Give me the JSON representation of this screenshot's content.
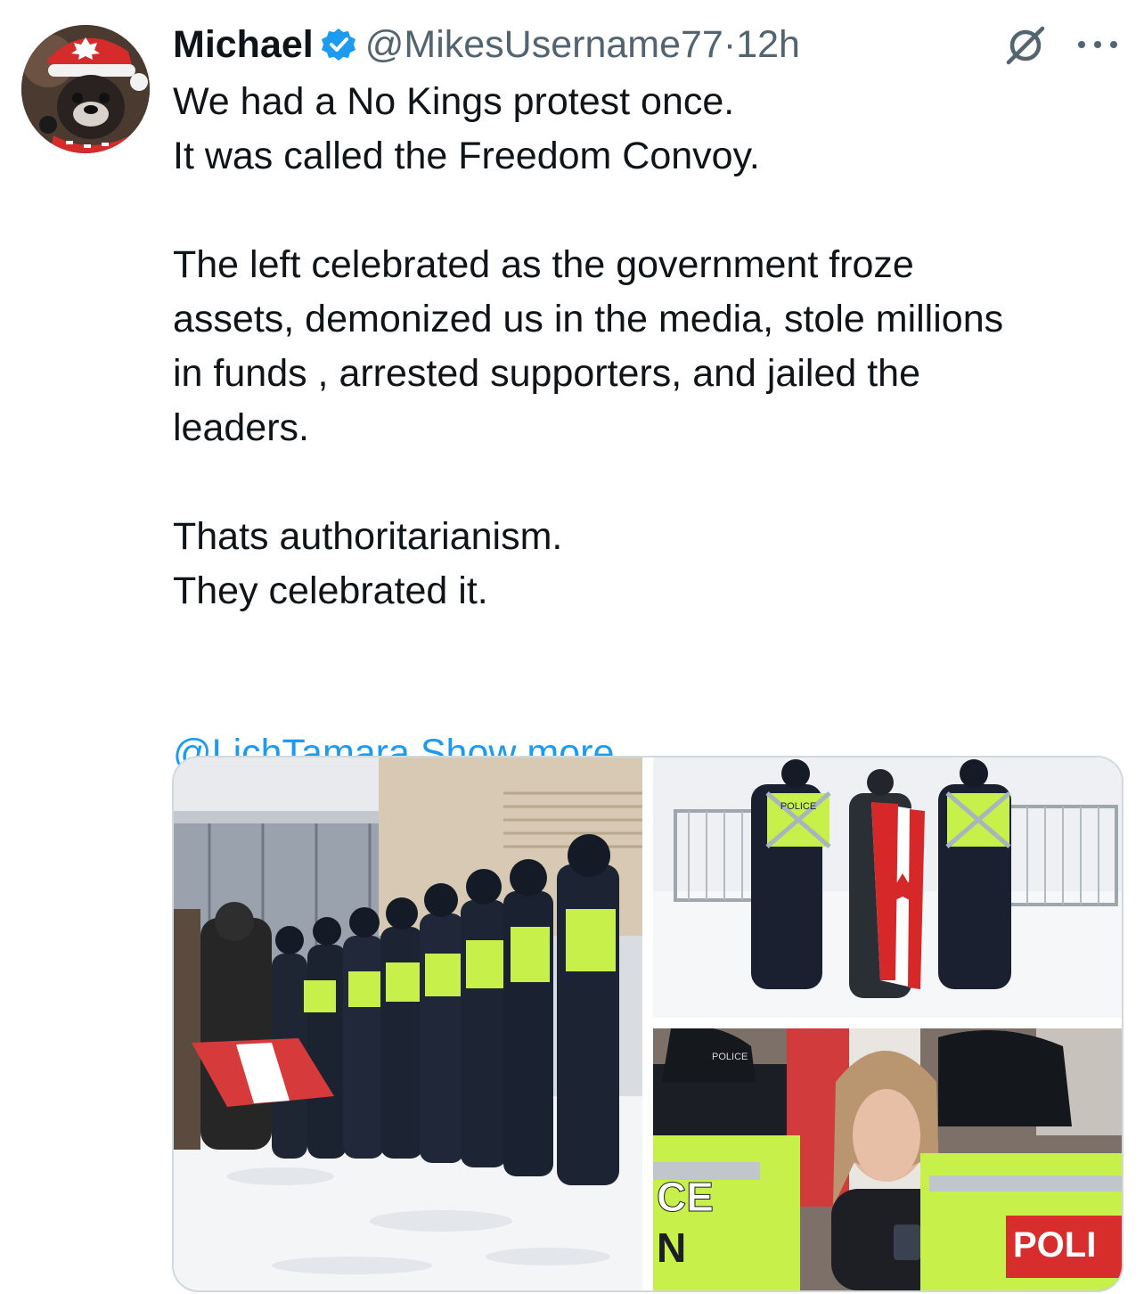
{
  "tweet": {
    "author_name": "Michael",
    "handle": "@MikesUsername77",
    "separator": "·",
    "time": "12h",
    "lines": [
      "We had a No Kings protest once.",
      "It was called the Freedom Convoy.",
      "The left celebrated as the government froze",
      "assets, demonized us in the media, stole millions",
      "in funds , arrested supporters, and jailed the",
      "leaders.",
      "Thats authoritarianism.",
      "They celebrated it."
    ],
    "mention": "@LichTamara",
    "show_more": "Show more",
    "photo_labels": {
      "police_vest": "POLICE",
      "police_hat": "POLICE",
      "vest_partial_left": "CE",
      "vest_partial_left_2": "N",
      "vest_partial_right": "POLI"
    }
  },
  "icons": {
    "verified": "verified-badge-icon",
    "grok": "grok-icon",
    "more": "more-options-icon"
  },
  "colors": {
    "link": "#1d9bf0",
    "secondary_text": "#536471",
    "verified": "#1d9bf0",
    "hi_vis": "#c8f04a"
  }
}
